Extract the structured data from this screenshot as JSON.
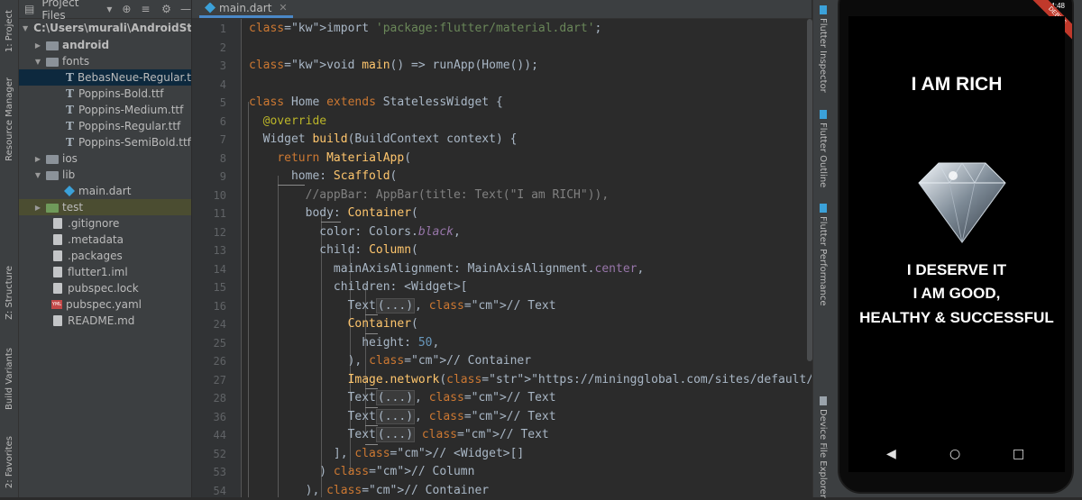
{
  "left_tool_tabs": [
    "1: Project",
    "Resource Manager",
    "Z: Structure",
    "Build Variants",
    "2: Favorites"
  ],
  "project_panel": {
    "title": "Project Files",
    "tree": [
      {
        "label": "C:\\Users\\murali\\AndroidStudio",
        "type": "root"
      },
      {
        "label": "android",
        "type": "folder"
      },
      {
        "label": "fonts",
        "type": "folder"
      },
      {
        "label": "BebasNeue-Regular.ttf",
        "type": "ttf"
      },
      {
        "label": "Poppins-Bold.ttf",
        "type": "ttf"
      },
      {
        "label": "Poppins-Medium.ttf",
        "type": "ttf"
      },
      {
        "label": "Poppins-Regular.ttf",
        "type": "ttf"
      },
      {
        "label": "Poppins-SemiBold.ttf",
        "type": "ttf"
      },
      {
        "label": "ios",
        "type": "folder"
      },
      {
        "label": "lib",
        "type": "folder"
      },
      {
        "label": "main.dart",
        "type": "dart"
      },
      {
        "label": "test",
        "type": "folder"
      },
      {
        "label": ".gitignore",
        "type": "file"
      },
      {
        "label": ".metadata",
        "type": "file"
      },
      {
        "label": ".packages",
        "type": "file"
      },
      {
        "label": "flutter1.iml",
        "type": "file"
      },
      {
        "label": "pubspec.lock",
        "type": "file"
      },
      {
        "label": "pubspec.yaml",
        "type": "yaml"
      },
      {
        "label": "README.md",
        "type": "file"
      }
    ]
  },
  "editor": {
    "tab_label": "main.dart",
    "line_numbers": [
      "1",
      "2",
      "3",
      "4",
      "5",
      "6",
      "7",
      "8",
      "9",
      "10",
      "11",
      "12",
      "13",
      "14",
      "15",
      "16",
      "24",
      "25",
      "26",
      "27",
      "28",
      "36",
      "44",
      "52",
      "53",
      "54"
    ],
    "lines": [
      "import 'package:flutter/material.dart';",
      "",
      "void main() => runApp(Home());",
      "",
      "class Home extends StatelessWidget {",
      "  @override",
      "  Widget build(BuildContext context) {",
      "    return MaterialApp(",
      "      home: Scaffold(",
      "        //appBar: AppBar(title: Text(\"I am RICH\")),",
      "        body: Container(",
      "          color: Colors.black,",
      "          child: Column(",
      "            mainAxisAlignment: MainAxisAlignment.center,",
      "            children: <Widget>[",
      "              Text(...), // Text",
      "              Container(",
      "                height: 50,",
      "              ), // Container",
      "              Image.network(\"https://miningglobal.com/sites/default/files/",
      "              Text(...), // Text",
      "              Text(...), // Text",
      "              Text(...) // Text",
      "            ], // <Widget>[]",
      "          ) // Column",
      "        ), // Container"
    ]
  },
  "right_tool_tabs": [
    "Flutter Inspector",
    "Flutter Outline",
    "Flutter Performance",
    "Device File Explorer"
  ],
  "phone": {
    "title_text": "I AM RICH",
    "line1": "I DESERVE IT",
    "line2": "I AM GOOD,",
    "line3": "HEALTHY & SUCCESSFUL",
    "status_time": "4:48",
    "debug_banner": "DEBUG"
  }
}
